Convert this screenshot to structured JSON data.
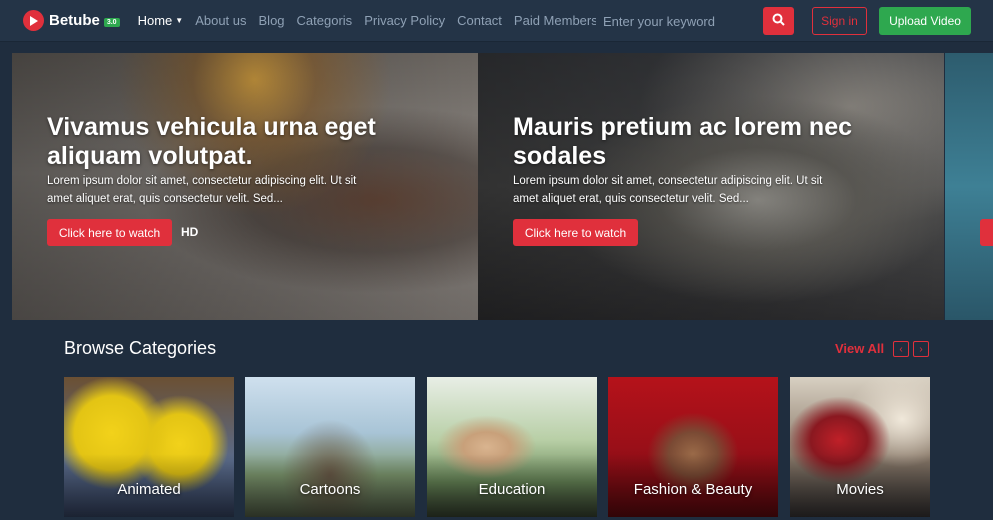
{
  "brand": {
    "name": "Betube",
    "badge": "3.0"
  },
  "nav": {
    "items": [
      {
        "label": "Home",
        "dropdown": true,
        "active": true
      },
      {
        "label": "About us",
        "dropdown": false
      },
      {
        "label": "Blog",
        "dropdown": false
      },
      {
        "label": "Categoris",
        "dropdown": false
      },
      {
        "label": "Privacy Policy",
        "dropdown": false
      },
      {
        "label": "Contact",
        "dropdown": false
      },
      {
        "label": "Paid Membership",
        "dropdown": true
      }
    ],
    "search_placeholder": "Enter your keyword",
    "signin_label": "Sign in",
    "upload_label": "Upload Video"
  },
  "hero": {
    "slides": [
      {
        "title": "Vivamus vehicula urna eget aliquam volutpat.",
        "description": "Lorem ipsum dolor sit amet, consectetur adipiscing elit. Ut sit amet aliquet erat, quis consectetur velit. Sed...",
        "button_label": "Click here to watch",
        "tag": "HD"
      },
      {
        "title": "Mauris pretium ac lorem nec sodales",
        "description": "Lorem ipsum dolor sit amet, consectetur adipiscing elit. Ut sit amet aliquet erat, quis consectetur velit. Sed...",
        "button_label": "Click here to watch"
      }
    ]
  },
  "categories": {
    "title": "Browse Categories",
    "view_all": "View All",
    "prev_icon": "‹",
    "next_icon": "›",
    "items": [
      {
        "label": "Animated"
      },
      {
        "label": "Cartoons"
      },
      {
        "label": "Education"
      },
      {
        "label": "Fashion & Beauty"
      },
      {
        "label": "Movies"
      }
    ]
  },
  "colors": {
    "background": "#1f2d3e",
    "navbar": "#243447",
    "accent_red": "#e0303c",
    "accent_green": "#2ea84f"
  }
}
